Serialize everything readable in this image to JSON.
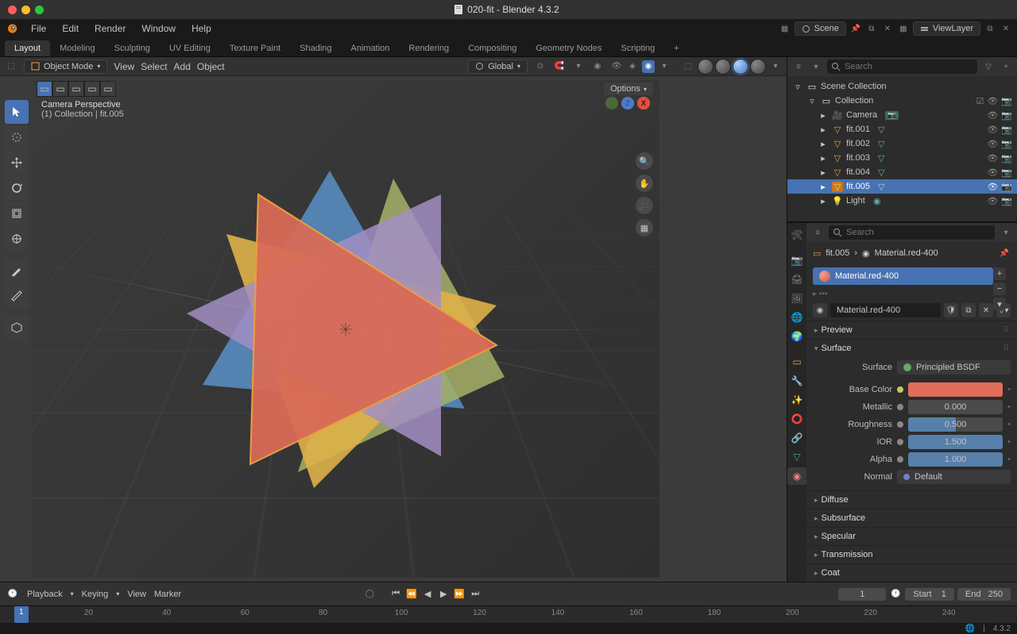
{
  "app": {
    "title": "020-fit - Blender 4.3.2",
    "version": "4.3.2"
  },
  "menubar": [
    "File",
    "Edit",
    "Render",
    "Window",
    "Help"
  ],
  "workspaces": {
    "active": 0,
    "tabs": [
      "Layout",
      "Modeling",
      "Sculpting",
      "UV Editing",
      "Texture Paint",
      "Shading",
      "Animation",
      "Rendering",
      "Compositing",
      "Geometry Nodes",
      "Scripting"
    ]
  },
  "scene": {
    "name": "Scene",
    "viewlayer": "ViewLayer"
  },
  "viewport": {
    "mode": "Object Mode",
    "menus": [
      "View",
      "Select",
      "Add",
      "Object"
    ],
    "orientation": "Global",
    "info_title": "Camera Perspective",
    "info_sub": "(1) Collection | fit.005",
    "options_label": "Options"
  },
  "outliner": {
    "search_placeholder": "Search",
    "root": "Scene Collection",
    "collection": "Collection",
    "items": [
      {
        "name": "Camera",
        "type": "camera",
        "selected": false
      },
      {
        "name": "fit.001",
        "type": "mesh",
        "selected": false
      },
      {
        "name": "fit.002",
        "type": "mesh",
        "selected": false
      },
      {
        "name": "fit.003",
        "type": "mesh",
        "selected": false
      },
      {
        "name": "fit.004",
        "type": "mesh",
        "selected": false
      },
      {
        "name": "fit.005",
        "type": "mesh",
        "selected": true
      },
      {
        "name": "Light",
        "type": "light",
        "selected": false
      }
    ]
  },
  "properties": {
    "search_placeholder": "Search",
    "breadcrumb_obj": "fit.005",
    "breadcrumb_mat": "Material.red-400",
    "material_slot": "Material.red-400",
    "material_name": "Material.red-400",
    "sections": {
      "preview": "Preview",
      "surface": "Surface",
      "diffuse": "Diffuse",
      "subsurface": "Subsurface",
      "specular": "Specular",
      "transmission": "Transmission",
      "coat": "Coat"
    },
    "surface": {
      "shader_label": "Surface",
      "shader_value": "Principled BSDF",
      "base_color_label": "Base Color",
      "base_color_hex": "#e16e5a",
      "metallic_label": "Metallic",
      "metallic_value": "0.000",
      "roughness_label": "Roughness",
      "roughness_value": "0.500",
      "ior_label": "IOR",
      "ior_value": "1.500",
      "alpha_label": "Alpha",
      "alpha_value": "1.000",
      "normal_label": "Normal",
      "normal_value": "Default"
    }
  },
  "timeline": {
    "menus": [
      "Playback",
      "Keying",
      "View",
      "Marker"
    ],
    "current": "1",
    "start_label": "Start",
    "start_value": "1",
    "end_label": "End",
    "end_value": "250",
    "ticks": [
      "20",
      "40",
      "60",
      "80",
      "100",
      "120",
      "140",
      "160",
      "180",
      "200",
      "220",
      "240"
    ]
  }
}
